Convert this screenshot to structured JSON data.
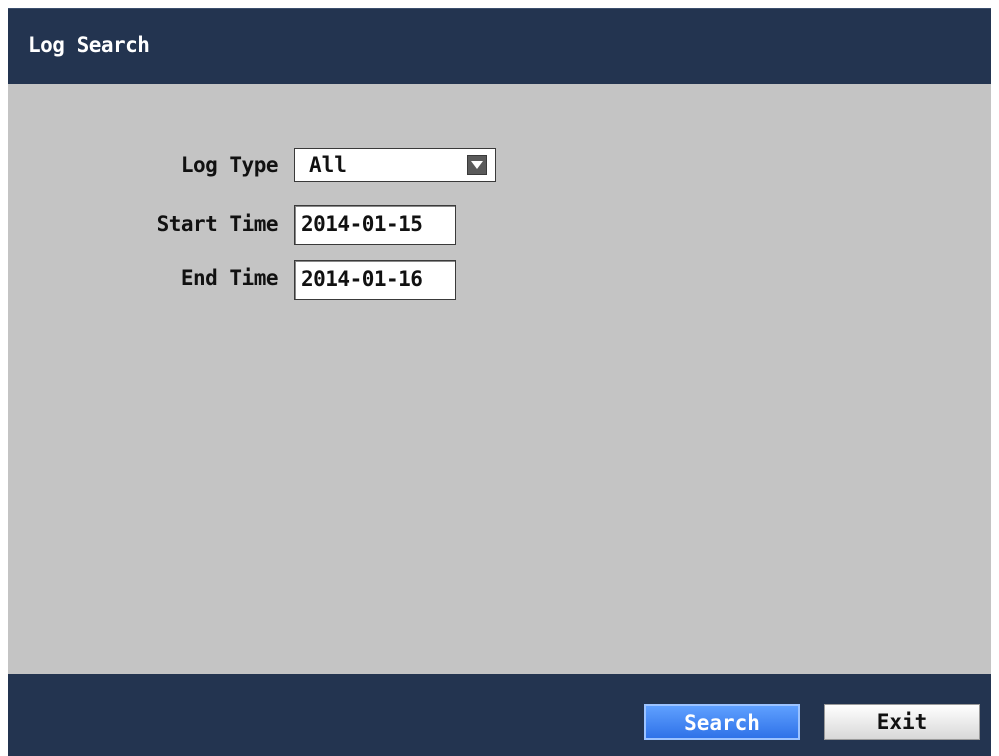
{
  "window": {
    "title": "Log Search"
  },
  "form": {
    "log_type_label": "Log Type",
    "log_type_value": "All",
    "start_time_label": "Start Time",
    "start_time_value": "2014-01-15",
    "end_time_label": "End Time",
    "end_time_value": "2014-01-16"
  },
  "footer": {
    "search_label": "Search",
    "exit_label": "Exit"
  },
  "colors": {
    "title_bar": "#233450",
    "panel_bg": "#c4c4c4",
    "primary_button": "#3a7cf0"
  },
  "icons": {
    "dropdown": "chevron-down-icon"
  }
}
